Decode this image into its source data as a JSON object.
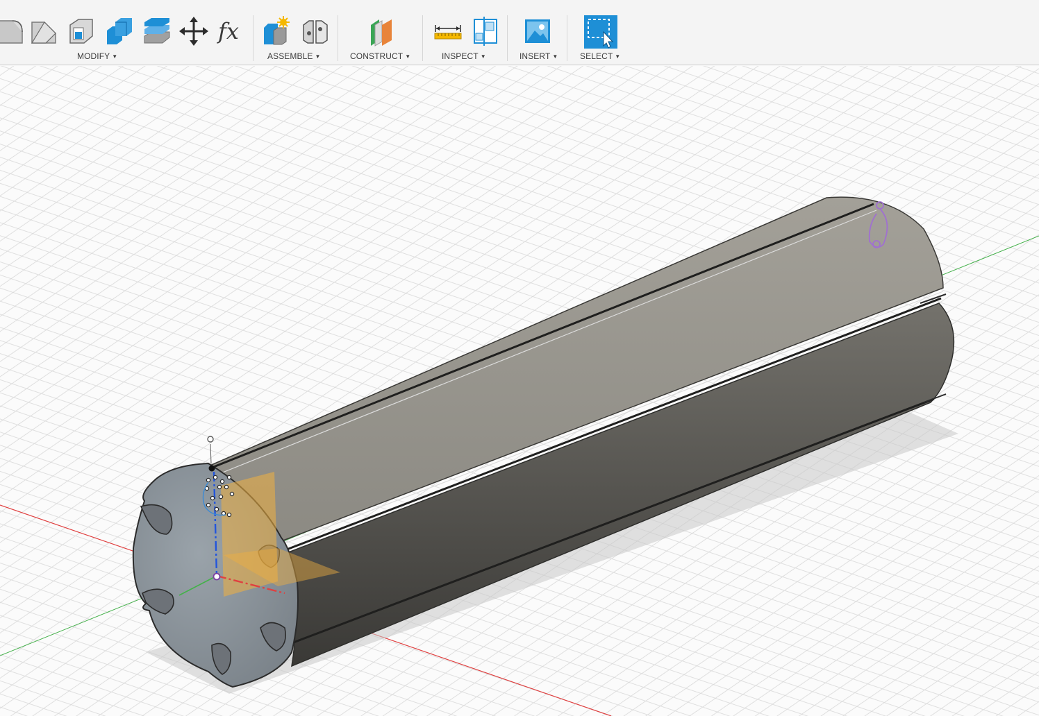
{
  "toolbar": {
    "groups": [
      {
        "id": "modify",
        "label": "MODIFY"
      },
      {
        "id": "assemble",
        "label": "ASSEMBLE"
      },
      {
        "id": "construct",
        "label": "CONSTRUCT"
      },
      {
        "id": "inspect",
        "label": "INSPECT"
      },
      {
        "id": "insert",
        "label": "INSERT"
      },
      {
        "id": "select",
        "label": "SELECT"
      }
    ],
    "tools": [
      {
        "name": "fillet-icon"
      },
      {
        "name": "chamfer-icon"
      },
      {
        "name": "shell-icon"
      },
      {
        "name": "combine-icon"
      },
      {
        "name": "offset-face-icon"
      },
      {
        "name": "move-icon"
      },
      {
        "name": "parameters-icon",
        "glyph": "fx"
      },
      {
        "name": "new-component-icon"
      },
      {
        "name": "joint-icon"
      },
      {
        "name": "offset-plane-icon"
      },
      {
        "name": "measure-icon"
      },
      {
        "name": "section-analysis-icon"
      },
      {
        "name": "insert-image-icon"
      },
      {
        "name": "select-window-icon"
      }
    ]
  },
  "colors": {
    "accent_blue": "#1e8fd6",
    "construct_green": "#3aa655",
    "construct_orange": "#e8843a",
    "axis_x": "#e04040",
    "axis_y": "#44b14a",
    "axis_z": "#2255dd",
    "sketch_plane": "#f0b040",
    "body_gray": "#8f8d85"
  }
}
